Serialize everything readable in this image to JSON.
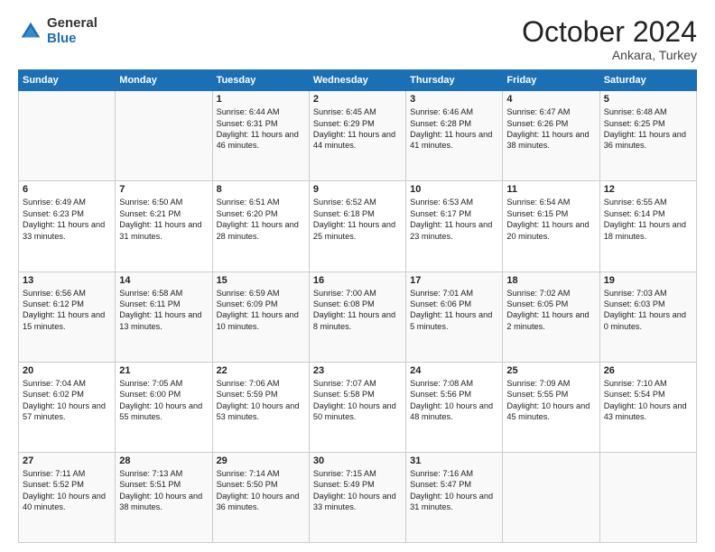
{
  "logo": {
    "general": "General",
    "blue": "Blue"
  },
  "header": {
    "month": "October 2024",
    "location": "Ankara, Turkey"
  },
  "weekdays": [
    "Sunday",
    "Monday",
    "Tuesday",
    "Wednesday",
    "Thursday",
    "Friday",
    "Saturday"
  ],
  "weeks": [
    [
      {
        "day": "",
        "content": ""
      },
      {
        "day": "",
        "content": ""
      },
      {
        "day": "1",
        "content": "Sunrise: 6:44 AM\nSunset: 6:31 PM\nDaylight: 11 hours and 46 minutes."
      },
      {
        "day": "2",
        "content": "Sunrise: 6:45 AM\nSunset: 6:29 PM\nDaylight: 11 hours and 44 minutes."
      },
      {
        "day": "3",
        "content": "Sunrise: 6:46 AM\nSunset: 6:28 PM\nDaylight: 11 hours and 41 minutes."
      },
      {
        "day": "4",
        "content": "Sunrise: 6:47 AM\nSunset: 6:26 PM\nDaylight: 11 hours and 38 minutes."
      },
      {
        "day": "5",
        "content": "Sunrise: 6:48 AM\nSunset: 6:25 PM\nDaylight: 11 hours and 36 minutes."
      }
    ],
    [
      {
        "day": "6",
        "content": "Sunrise: 6:49 AM\nSunset: 6:23 PM\nDaylight: 11 hours and 33 minutes."
      },
      {
        "day": "7",
        "content": "Sunrise: 6:50 AM\nSunset: 6:21 PM\nDaylight: 11 hours and 31 minutes."
      },
      {
        "day": "8",
        "content": "Sunrise: 6:51 AM\nSunset: 6:20 PM\nDaylight: 11 hours and 28 minutes."
      },
      {
        "day": "9",
        "content": "Sunrise: 6:52 AM\nSunset: 6:18 PM\nDaylight: 11 hours and 25 minutes."
      },
      {
        "day": "10",
        "content": "Sunrise: 6:53 AM\nSunset: 6:17 PM\nDaylight: 11 hours and 23 minutes."
      },
      {
        "day": "11",
        "content": "Sunrise: 6:54 AM\nSunset: 6:15 PM\nDaylight: 11 hours and 20 minutes."
      },
      {
        "day": "12",
        "content": "Sunrise: 6:55 AM\nSunset: 6:14 PM\nDaylight: 11 hours and 18 minutes."
      }
    ],
    [
      {
        "day": "13",
        "content": "Sunrise: 6:56 AM\nSunset: 6:12 PM\nDaylight: 11 hours and 15 minutes."
      },
      {
        "day": "14",
        "content": "Sunrise: 6:58 AM\nSunset: 6:11 PM\nDaylight: 11 hours and 13 minutes."
      },
      {
        "day": "15",
        "content": "Sunrise: 6:59 AM\nSunset: 6:09 PM\nDaylight: 11 hours and 10 minutes."
      },
      {
        "day": "16",
        "content": "Sunrise: 7:00 AM\nSunset: 6:08 PM\nDaylight: 11 hours and 8 minutes."
      },
      {
        "day": "17",
        "content": "Sunrise: 7:01 AM\nSunset: 6:06 PM\nDaylight: 11 hours and 5 minutes."
      },
      {
        "day": "18",
        "content": "Sunrise: 7:02 AM\nSunset: 6:05 PM\nDaylight: 11 hours and 2 minutes."
      },
      {
        "day": "19",
        "content": "Sunrise: 7:03 AM\nSunset: 6:03 PM\nDaylight: 11 hours and 0 minutes."
      }
    ],
    [
      {
        "day": "20",
        "content": "Sunrise: 7:04 AM\nSunset: 6:02 PM\nDaylight: 10 hours and 57 minutes."
      },
      {
        "day": "21",
        "content": "Sunrise: 7:05 AM\nSunset: 6:00 PM\nDaylight: 10 hours and 55 minutes."
      },
      {
        "day": "22",
        "content": "Sunrise: 7:06 AM\nSunset: 5:59 PM\nDaylight: 10 hours and 53 minutes."
      },
      {
        "day": "23",
        "content": "Sunrise: 7:07 AM\nSunset: 5:58 PM\nDaylight: 10 hours and 50 minutes."
      },
      {
        "day": "24",
        "content": "Sunrise: 7:08 AM\nSunset: 5:56 PM\nDaylight: 10 hours and 48 minutes."
      },
      {
        "day": "25",
        "content": "Sunrise: 7:09 AM\nSunset: 5:55 PM\nDaylight: 10 hours and 45 minutes."
      },
      {
        "day": "26",
        "content": "Sunrise: 7:10 AM\nSunset: 5:54 PM\nDaylight: 10 hours and 43 minutes."
      }
    ],
    [
      {
        "day": "27",
        "content": "Sunrise: 7:11 AM\nSunset: 5:52 PM\nDaylight: 10 hours and 40 minutes."
      },
      {
        "day": "28",
        "content": "Sunrise: 7:13 AM\nSunset: 5:51 PM\nDaylight: 10 hours and 38 minutes."
      },
      {
        "day": "29",
        "content": "Sunrise: 7:14 AM\nSunset: 5:50 PM\nDaylight: 10 hours and 36 minutes."
      },
      {
        "day": "30",
        "content": "Sunrise: 7:15 AM\nSunset: 5:49 PM\nDaylight: 10 hours and 33 minutes."
      },
      {
        "day": "31",
        "content": "Sunrise: 7:16 AM\nSunset: 5:47 PM\nDaylight: 10 hours and 31 minutes."
      },
      {
        "day": "",
        "content": ""
      },
      {
        "day": "",
        "content": ""
      }
    ]
  ]
}
